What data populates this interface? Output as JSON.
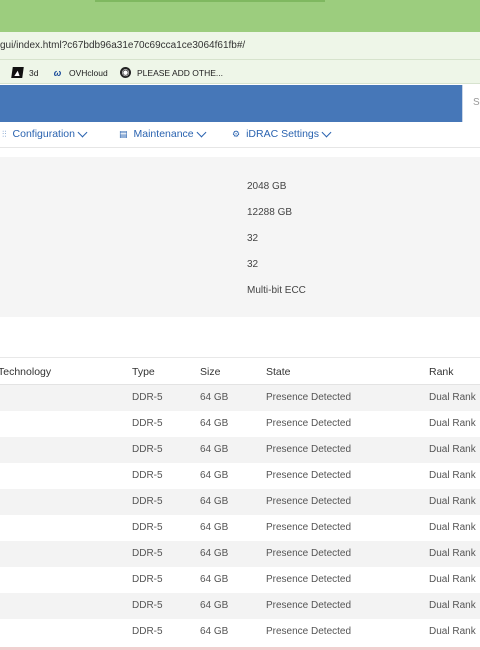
{
  "browser": {
    "url": "gui/index.html?c67bdb96a31e70c69cca1ce3064f61fb#/",
    "bookmarks": [
      {
        "icon": "3d-icon",
        "label": "3d"
      },
      {
        "icon": "ovh-icon",
        "label": "OVHcloud"
      },
      {
        "icon": "globe-icon",
        "label": "PLEASE ADD OTHE..."
      }
    ]
  },
  "header": {
    "search_placeholder": "Se"
  },
  "nav": {
    "items": [
      {
        "icon": "sliders-icon",
        "label": "Configuration"
      },
      {
        "icon": "maintenance-icon",
        "label": "Maintenance"
      },
      {
        "icon": "settings-icon",
        "label": "iDRAC Settings"
      }
    ]
  },
  "memory_summary": {
    "values": [
      "2048 GB",
      "12288 GB",
      "32",
      "32",
      "Multi-bit ECC"
    ]
  },
  "dimm_table": {
    "columns": [
      "Technology",
      "Type",
      "Size",
      "State",
      "Rank"
    ],
    "rows": [
      {
        "type": "DDR-5",
        "size": "64 GB",
        "state": "Presence Detected",
        "rank": "Dual Rank"
      },
      {
        "type": "DDR-5",
        "size": "64 GB",
        "state": "Presence Detected",
        "rank": "Dual Rank"
      },
      {
        "type": "DDR-5",
        "size": "64 GB",
        "state": "Presence Detected",
        "rank": "Dual Rank"
      },
      {
        "type": "DDR-5",
        "size": "64 GB",
        "state": "Presence Detected",
        "rank": "Dual Rank"
      },
      {
        "type": "DDR-5",
        "size": "64 GB",
        "state": "Presence Detected",
        "rank": "Dual Rank"
      },
      {
        "type": "DDR-5",
        "size": "64 GB",
        "state": "Presence Detected",
        "rank": "Dual Rank"
      },
      {
        "type": "DDR-5",
        "size": "64 GB",
        "state": "Presence Detected",
        "rank": "Dual Rank"
      },
      {
        "type": "DDR-5",
        "size": "64 GB",
        "state": "Presence Detected",
        "rank": "Dual Rank"
      },
      {
        "type": "DDR-5",
        "size": "64 GB",
        "state": "Presence Detected",
        "rank": "Dual Rank"
      },
      {
        "type": "DDR-5",
        "size": "64 GB",
        "state": "Presence Detected",
        "rank": "Dual Rank"
      }
    ]
  },
  "colors": {
    "titlebar": "#9ccd7e",
    "banner": "#4677b8",
    "nav_text": "#2a63b0"
  }
}
